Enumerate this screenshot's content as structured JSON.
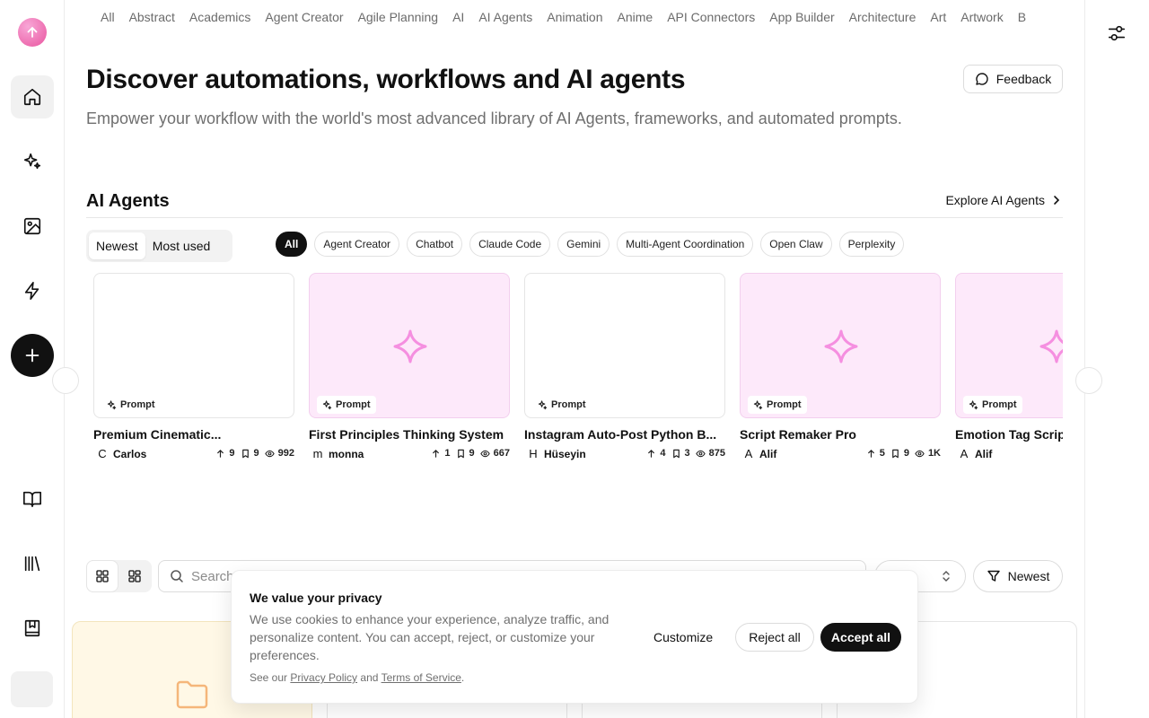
{
  "categories": [
    "All",
    "Abstract",
    "Academics",
    "Agent Creator",
    "Agile Planning",
    "AI",
    "AI Agents",
    "Animation",
    "Anime",
    "API Connectors",
    "App Builder",
    "Architecture",
    "Art",
    "Artwork",
    "B"
  ],
  "hero": {
    "title": "Discover automations, workflows and AI agents",
    "subtitle": "Empower your workflow with the world's most advanced library of AI Agents, frameworks, and automated prompts."
  },
  "feedback_label": "Feedback",
  "section": {
    "title": "AI Agents",
    "explore_label": "Explore AI Agents"
  },
  "sort_toggle": {
    "newest": "Newest",
    "most_used": "Most used"
  },
  "chips": [
    "All",
    "Agent Creator",
    "Chatbot",
    "Claude Code",
    "Gemini",
    "Multi-Agent Coordination",
    "Open Claw",
    "Perplexity"
  ],
  "cards": [
    {
      "title": "Premium Cinematic...",
      "tag": "Prompt",
      "author_initial": "C",
      "author": "Carlos",
      "upvotes": "9",
      "saves": "9",
      "views": "992",
      "thumb": "white"
    },
    {
      "title": "First Principles Thinking System",
      "tag": "Prompt",
      "author_initial": "m",
      "author": "monna",
      "upvotes": "1",
      "saves": "9",
      "views": "667",
      "thumb": "pink"
    },
    {
      "title": "Instagram Auto-Post Python B...",
      "tag": "Prompt",
      "author_initial": "H",
      "author": "Hüseyin",
      "upvotes": "4",
      "saves": "3",
      "views": "875",
      "thumb": "white"
    },
    {
      "title": "Script Remaker Pro",
      "tag": "Prompt",
      "author_initial": "A",
      "author": "Alif",
      "upvotes": "5",
      "saves": "9",
      "views": "1K",
      "thumb": "pink"
    },
    {
      "title": "Emotion Tag Scrip",
      "tag": "Prompt",
      "author_initial": "A",
      "author": "Alif",
      "upvotes": "",
      "saves": "",
      "views": "",
      "thumb": "pink"
    }
  ],
  "filters": {
    "search_placeholder": "Search",
    "select_value": "s",
    "sort_label": "Newest"
  },
  "cookie": {
    "title": "We value your privacy",
    "text": "We use cookies to enhance your experience, analyze traffic, and personalize content. You can accept, reject, or customize your preferences.",
    "footer_prefix": "See our",
    "privacy_link": "Privacy Policy",
    "and": "and",
    "terms_link": "Terms of Service",
    "period": ".",
    "customize": "Customize",
    "reject": "Reject all",
    "accept": "Accept all"
  },
  "colors": {
    "accent_pink": "#e9559f",
    "star_pink": "#f5a0e6",
    "dark": "#111111"
  }
}
